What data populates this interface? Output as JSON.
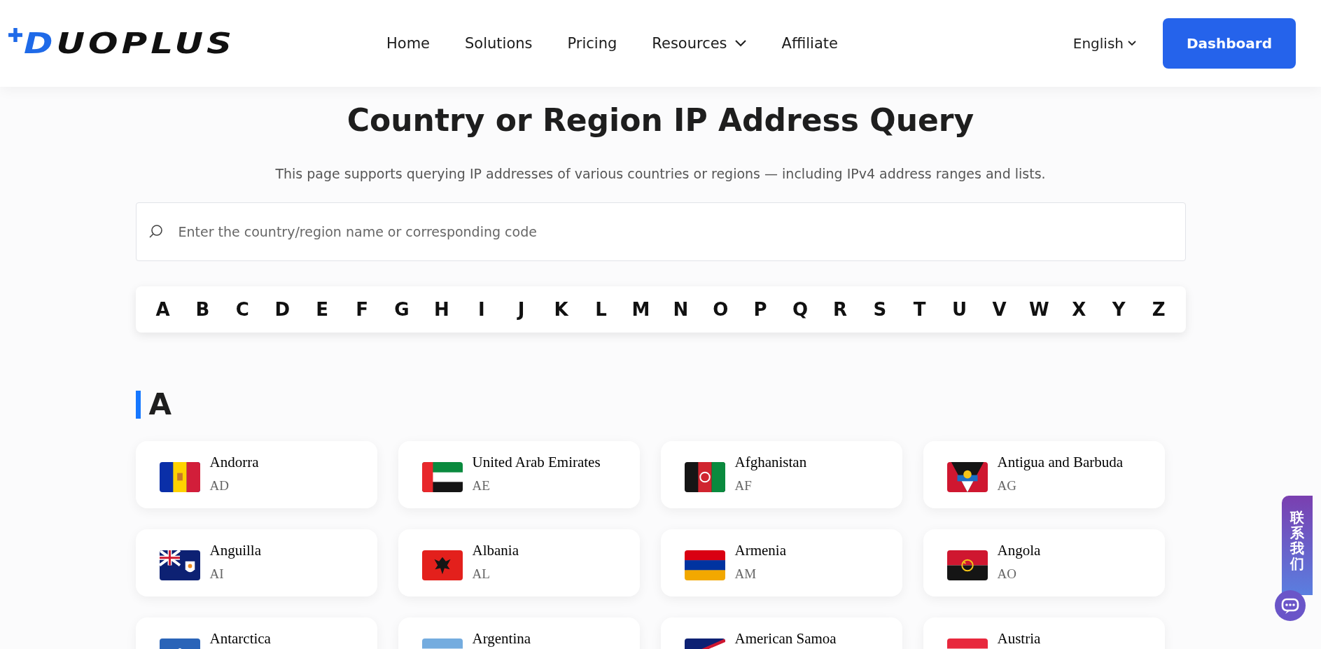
{
  "header": {
    "logo": "DUOPLUS",
    "nav": [
      {
        "label": "Home",
        "kind": "link"
      },
      {
        "label": "Solutions",
        "kind": "link"
      },
      {
        "label": "Pricing",
        "kind": "link"
      },
      {
        "label": "Resources",
        "kind": "menu"
      },
      {
        "label": "Affiliate",
        "kind": "link"
      }
    ],
    "language": "English",
    "dashboard_button": "Dashboard"
  },
  "title": "Country or Region IP Address Query",
  "subtitle": "This page supports querying IP addresses of various countries or regions — including IPv4 address ranges and lists.",
  "search": {
    "placeholder": "Enter the country/region name or corresponding code"
  },
  "letters": [
    "A",
    "B",
    "C",
    "D",
    "E",
    "F",
    "G",
    "H",
    "I",
    "J",
    "K",
    "L",
    "M",
    "N",
    "O",
    "P",
    "Q",
    "R",
    "S",
    "T",
    "U",
    "V",
    "W",
    "X",
    "Y",
    "Z"
  ],
  "sections": [
    {
      "letter": "A",
      "countries": [
        {
          "name": "Andorra",
          "code": "AD"
        },
        {
          "name": "United Arab Emirates",
          "code": "AE"
        },
        {
          "name": "Afghanistan",
          "code": "AF"
        },
        {
          "name": "Antigua and Barbuda",
          "code": "AG"
        },
        {
          "name": "Anguilla",
          "code": "AI"
        },
        {
          "name": "Albania",
          "code": "AL"
        },
        {
          "name": "Armenia",
          "code": "AM"
        },
        {
          "name": "Angola",
          "code": "AO"
        },
        {
          "name": "Antarctica"
        },
        {
          "name": "Argentina"
        },
        {
          "name": "American Samoa"
        },
        {
          "name": "Austria"
        }
      ]
    }
  ],
  "contact_tab": {
    "label": "联系我们"
  }
}
